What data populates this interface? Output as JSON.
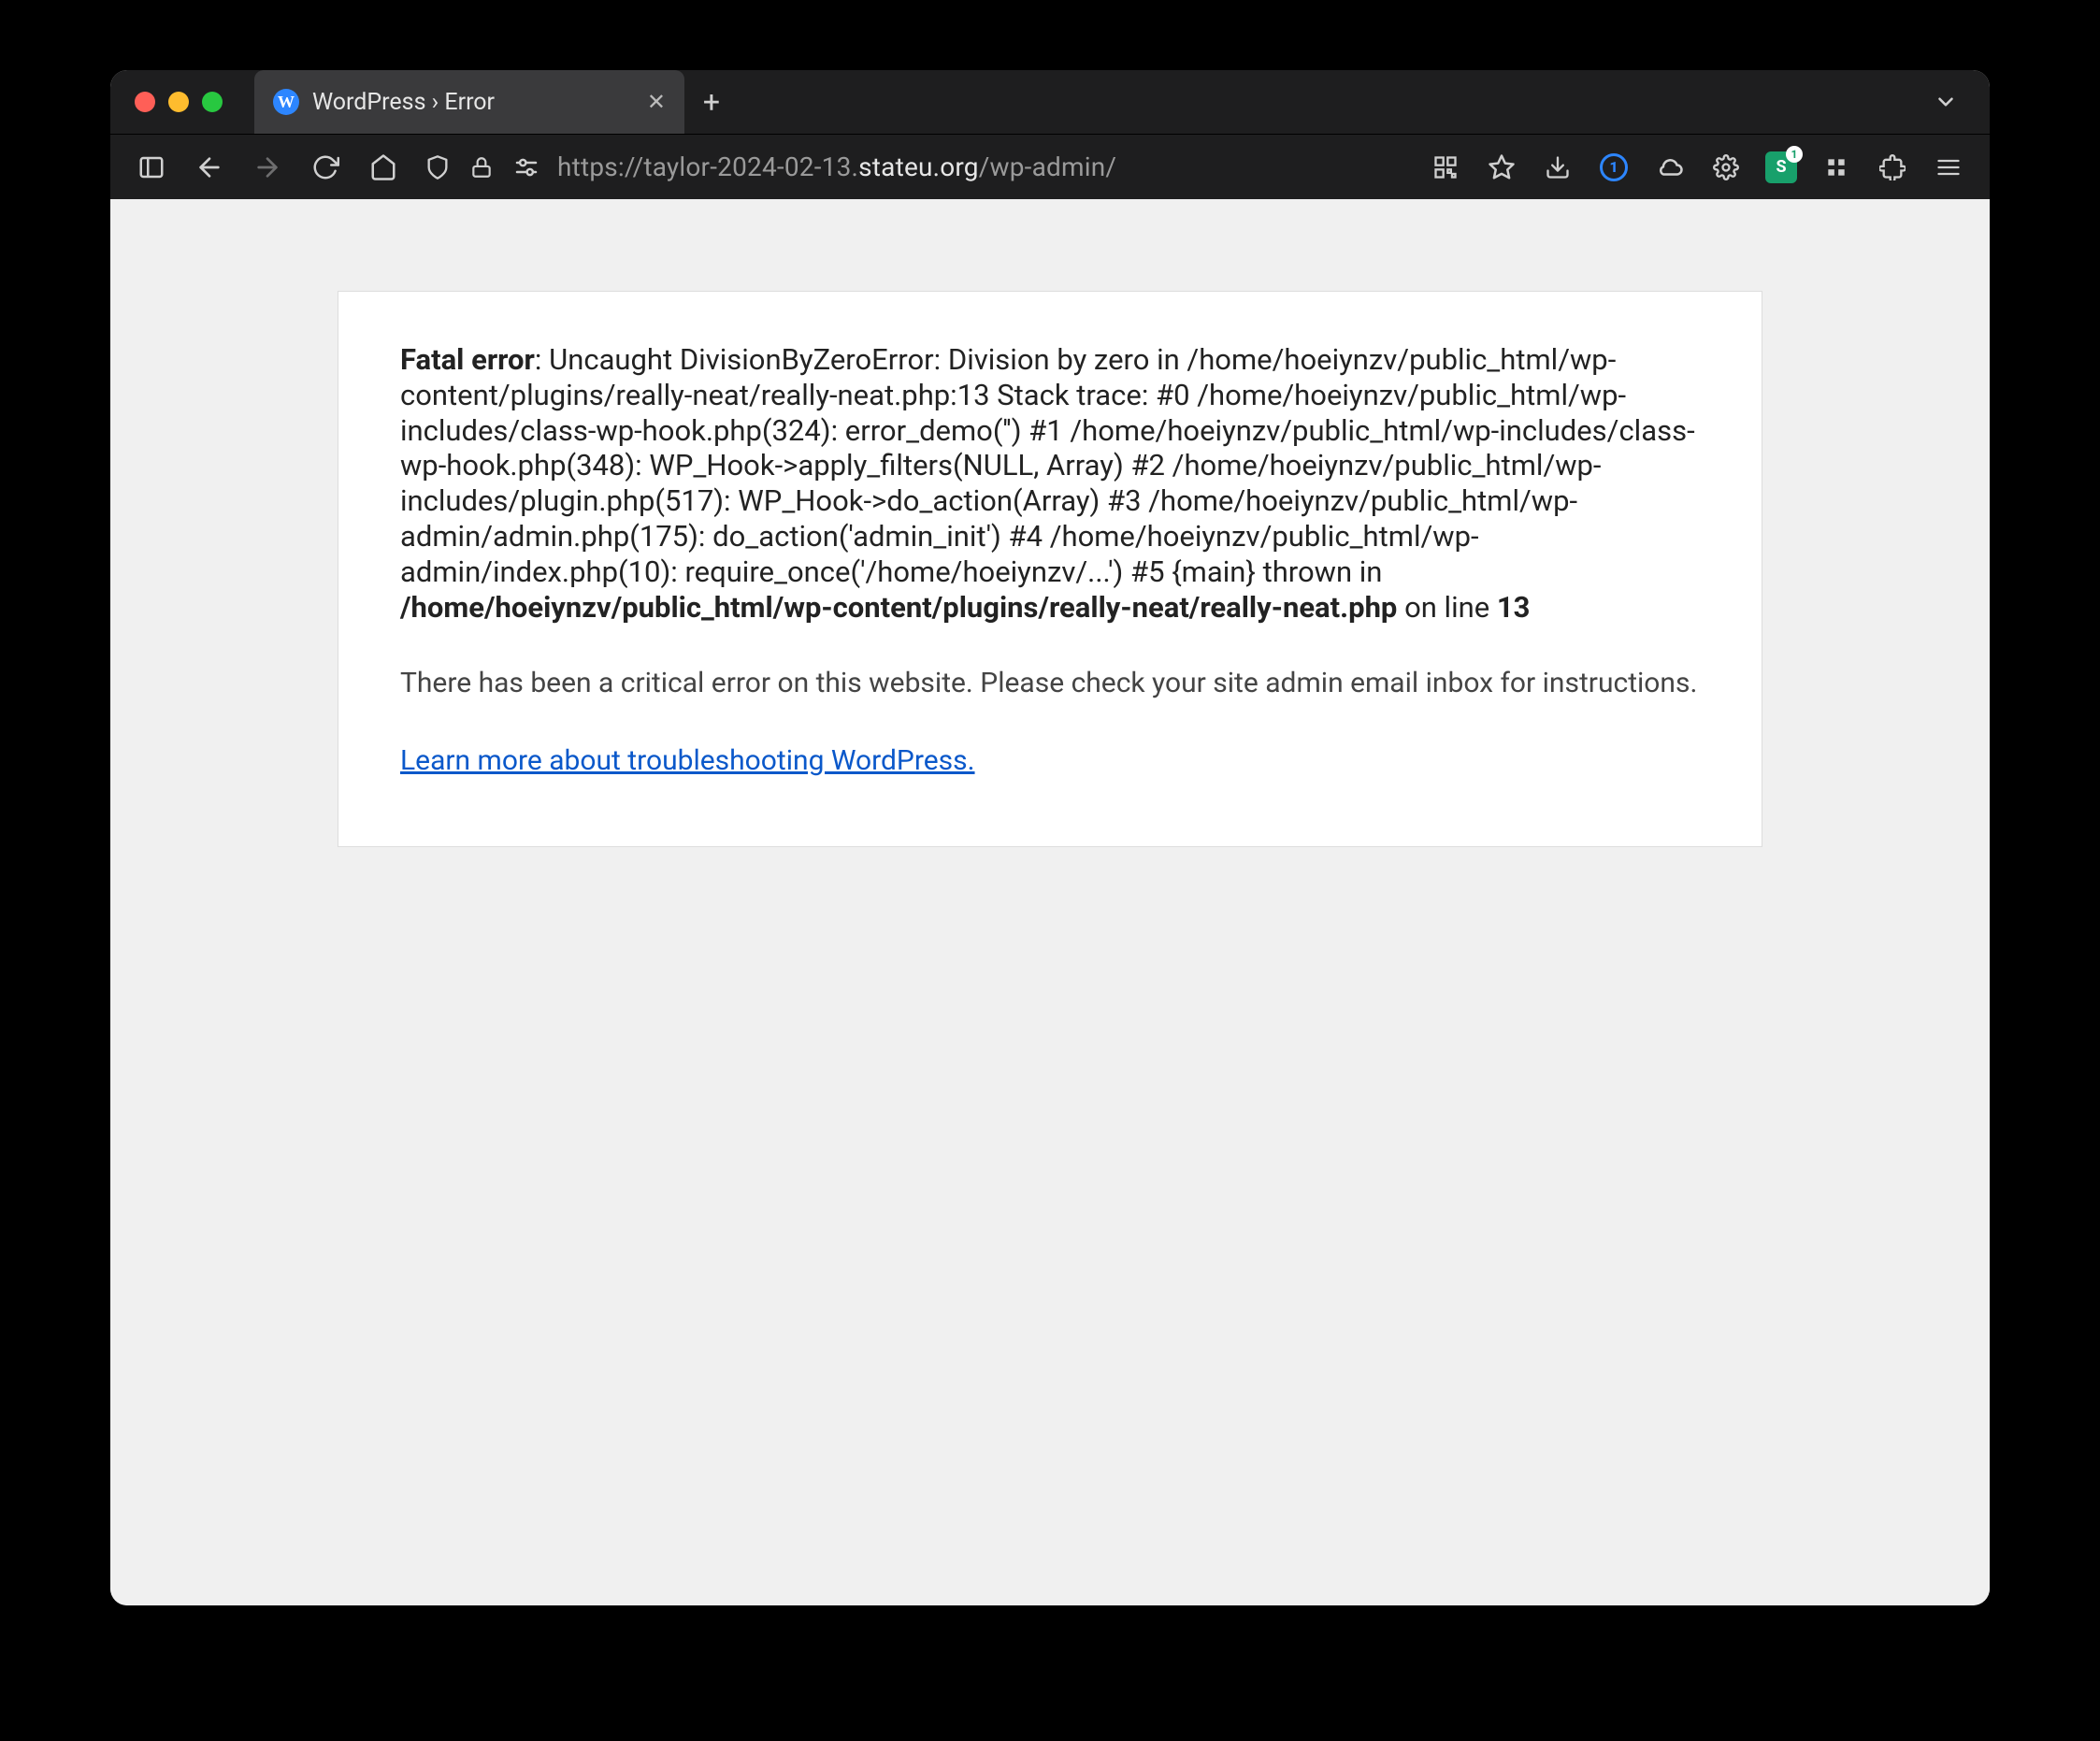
{
  "tab": {
    "title": "WordPress › Error",
    "favicon_letter": "W"
  },
  "url": {
    "prefix": "https://taylor-2024-02-13.",
    "bold": "stateu.org",
    "suffix": "/wp-admin/"
  },
  "ext": {
    "letter": "S",
    "count": "1"
  },
  "error": {
    "label": "Fatal error",
    "body": ": Uncaught DivisionByZeroError: Division by zero in /home/hoeiynzv/public_html/wp-content/plugins/really-neat/really-neat.php:13 Stack trace: #0 /home/hoeiynzv/public_html/wp-includes/class-wp-hook.php(324): error_demo('') #1 /home/hoeiynzv/public_html/wp-includes/class-wp-hook.php(348): WP_Hook->apply_filters(NULL, Array) #2 /home/hoeiynzv/public_html/wp-includes/plugin.php(517): WP_Hook->do_action(Array) #3 /home/hoeiynzv/public_html/wp-admin/admin.php(175): do_action('admin_init') #4 /home/hoeiynzv/public_html/wp-admin/index.php(10): require_once('/home/hoeiynzv/...') #5 {main} thrown in ",
    "file": "/home/hoeiynzv/public_html/wp-content/plugins/really-neat/really-neat.php",
    "on_line": " on line ",
    "line": "13"
  },
  "critical": "There has been a critical error on this website. Please check your site admin email inbox for instructions.",
  "learn": "Learn more about troubleshooting WordPress."
}
